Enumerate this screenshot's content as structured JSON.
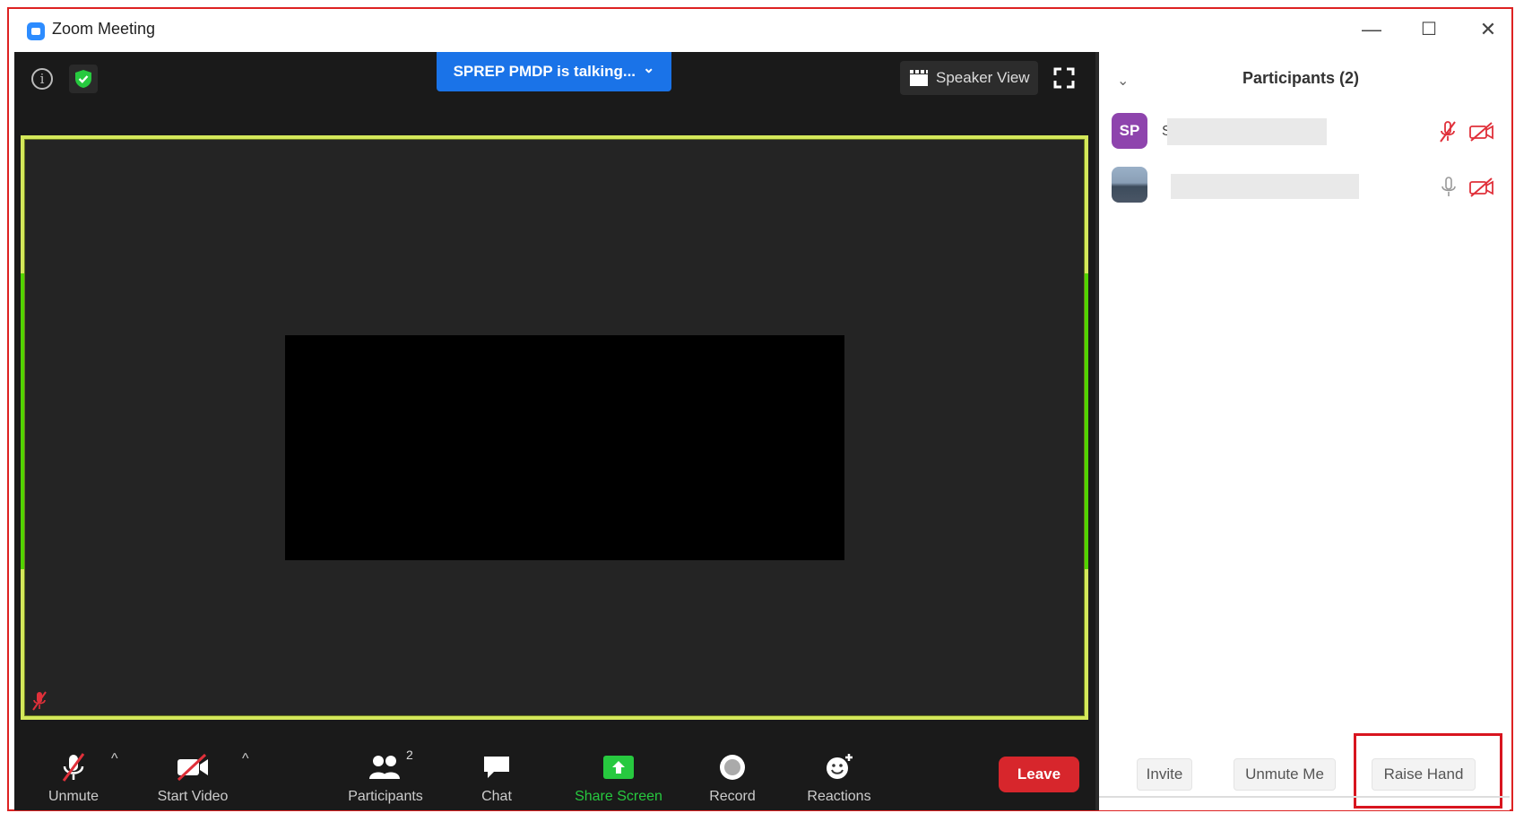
{
  "window": {
    "title": "Zoom Meeting",
    "controls": {
      "minimize": "—",
      "maximize": "☐",
      "close": "✕"
    }
  },
  "meeting": {
    "info_icon": "i",
    "talking_banner": "SPREP PMDP is talking...",
    "talking_chevron": "⌄",
    "speaker_view_label": "Speaker View"
  },
  "toolbar": {
    "unmute_label": "Unmute",
    "start_video_label": "Start Video",
    "participants_label": "Participants",
    "participants_count": "2",
    "chat_label": "Chat",
    "share_screen_label": "Share Screen",
    "record_label": "Record",
    "reactions_label": "Reactions",
    "leave_label": "Leave",
    "caret": "^"
  },
  "participants_panel": {
    "title": "Participants (2)",
    "collapse_chevron": "⌄",
    "participants": [
      {
        "avatar_initials": "SP",
        "name_initial": "S"
      },
      {
        "avatar_initials": ""
      }
    ],
    "buttons": {
      "invite": "Invite",
      "unmute_me": "Unmute Me",
      "raise_hand": "Raise Hand"
    }
  },
  "colors": {
    "accent_blue": "#1a73e8",
    "active_speaker_border": "#d4e85a",
    "share_screen_green": "#27c93f",
    "leave_red": "#d7262c",
    "muted_red": "#e0303a",
    "highlight_red": "#d8151f"
  },
  "icons": [
    "info-icon",
    "shield-icon",
    "speaker-view-icon",
    "fullscreen-icon",
    "mic-muted-icon",
    "video-off-icon",
    "participants-icon",
    "chat-icon",
    "share-screen-icon",
    "record-icon",
    "reactions-icon",
    "mic-icon",
    "camera-off-icon",
    "chevron-down-icon"
  ]
}
